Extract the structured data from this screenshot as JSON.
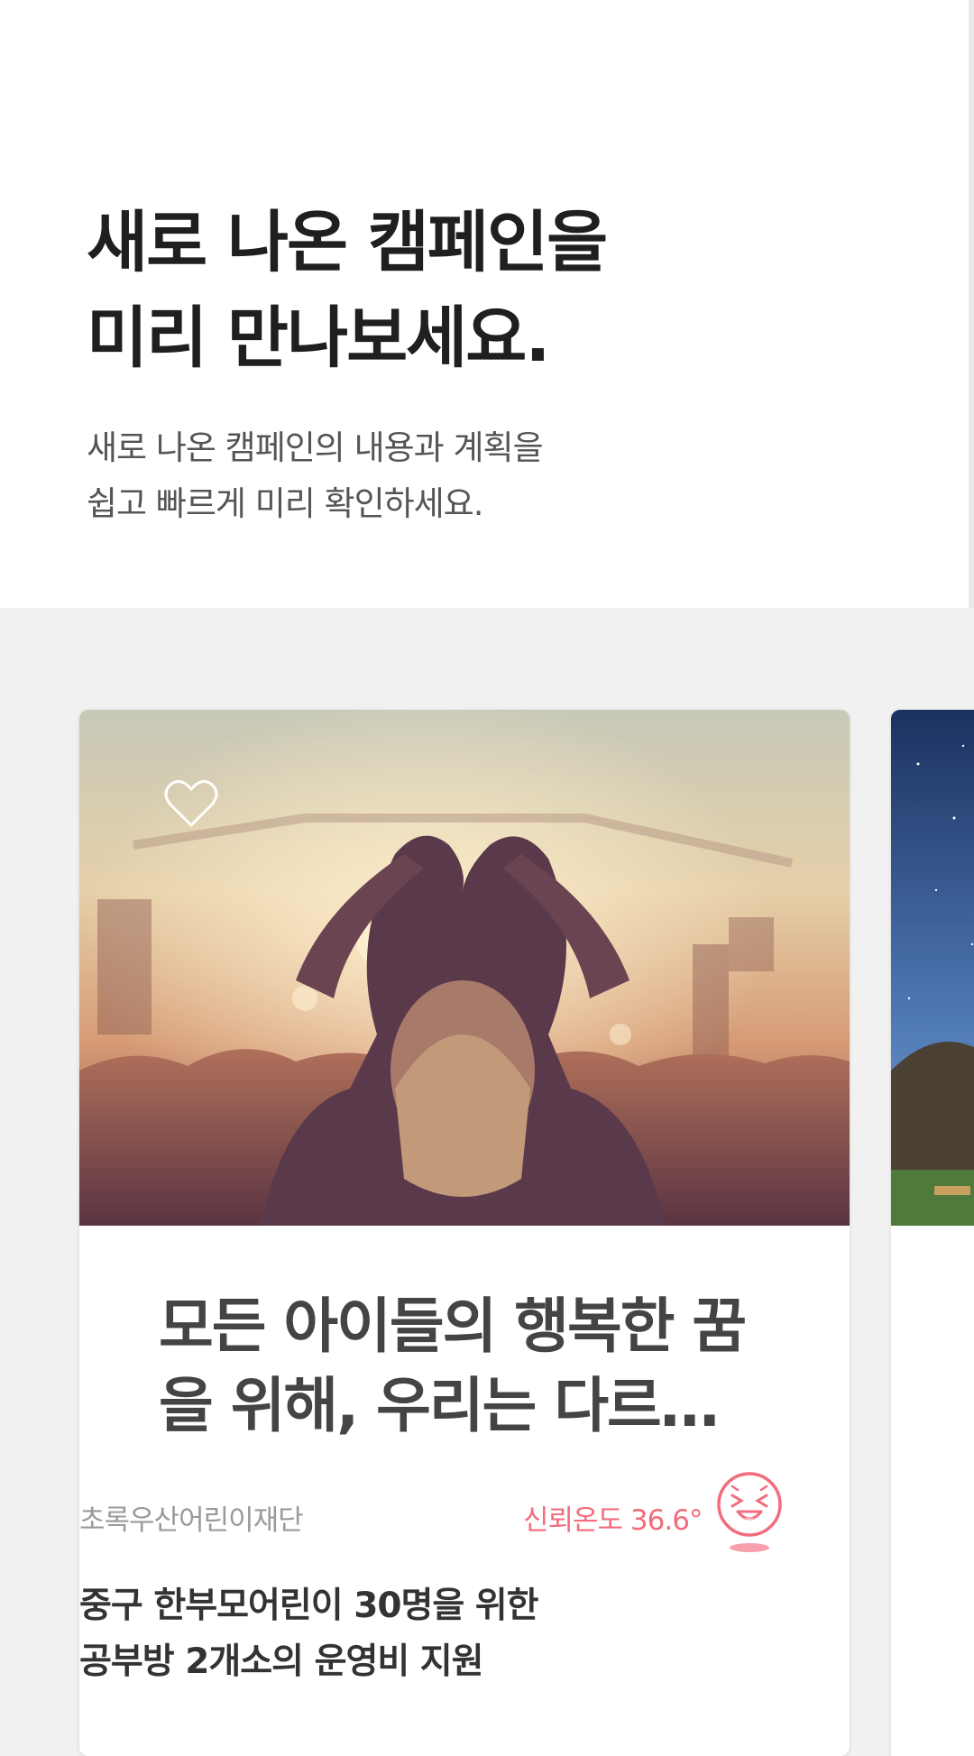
{
  "hero": {
    "title_line1": "새로 나온 캠페인을",
    "title_line2": "미리 만나보세요.",
    "subtitle_line1": "새로 나온 캠페인의 내용과 계획을",
    "subtitle_line2": "쉽고 빠르게 미리 확인하세요."
  },
  "campaign": {
    "title": "모든 아이들의 행복한 꿈을 위해, 우리는 다르지 않습니다",
    "organization": "초록우산어린이재단",
    "trust_label": "신뢰온도 36.6°",
    "description_line1": "중구 한부모어린이 30명을 위한",
    "description_line2": "공부방 2개소의 운영비 지원",
    "favorite_icon": "heart-outline-icon",
    "trust_icon": "laughing-face-icon"
  },
  "colors": {
    "accent": "#f26d7d",
    "page_bg": "#f1f1f1"
  }
}
